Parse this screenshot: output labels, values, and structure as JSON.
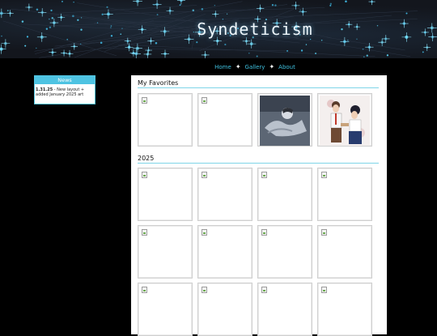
{
  "header": {
    "title": "Syndeticism"
  },
  "nav": [
    {
      "label": "Home"
    },
    {
      "label": "Gallery"
    },
    {
      "label": "About"
    }
  ],
  "news": {
    "title": "News",
    "entries": [
      {
        "date": "1.31.25",
        "text": " - New layout + added January 2025 art"
      }
    ]
  },
  "sections": [
    {
      "title": "My Favorites",
      "thumbnails": [
        "broken",
        "broken",
        "art-sleeping-figure",
        "art-couple-illustration"
      ]
    },
    {
      "title": "2025",
      "thumbnails": [
        "broken",
        "broken",
        "broken",
        "broken",
        "broken",
        "broken",
        "broken",
        "broken",
        "broken",
        "broken",
        "broken",
        "broken"
      ]
    }
  ],
  "colors": {
    "accent": "#4ec3e2",
    "nav_link": "#3fc0df",
    "header_bg": "#13161d",
    "page_bg": "#000000"
  }
}
